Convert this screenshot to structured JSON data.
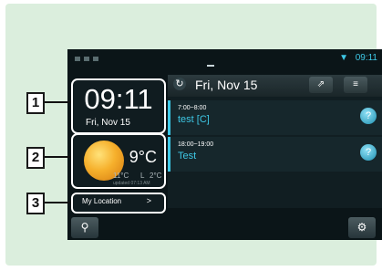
{
  "status_bar": {
    "time": "09:11",
    "wifi_icon": "wifi-icon"
  },
  "clock_widget": {
    "time": "09:11",
    "date": "Fri, Nov 15"
  },
  "weather_widget": {
    "temp": "9°C",
    "high": "11°C",
    "low_sep": "L",
    "low": "2°C",
    "updated": "updated 07:13 AM"
  },
  "location_widget": {
    "label": "My Location",
    "arrow": ">"
  },
  "calendar": {
    "date": "Fri, Nov 15",
    "events": [
      {
        "time": "7:00~8:00",
        "title": "test [C]"
      },
      {
        "time": "18:00~19:00",
        "title": "Test"
      }
    ]
  },
  "markers": [
    "1",
    "2",
    "3"
  ],
  "colors": {
    "accent": "#3ec8e6",
    "panel_bg": "#dbeedd",
    "screen_bg": "#0b1518"
  }
}
